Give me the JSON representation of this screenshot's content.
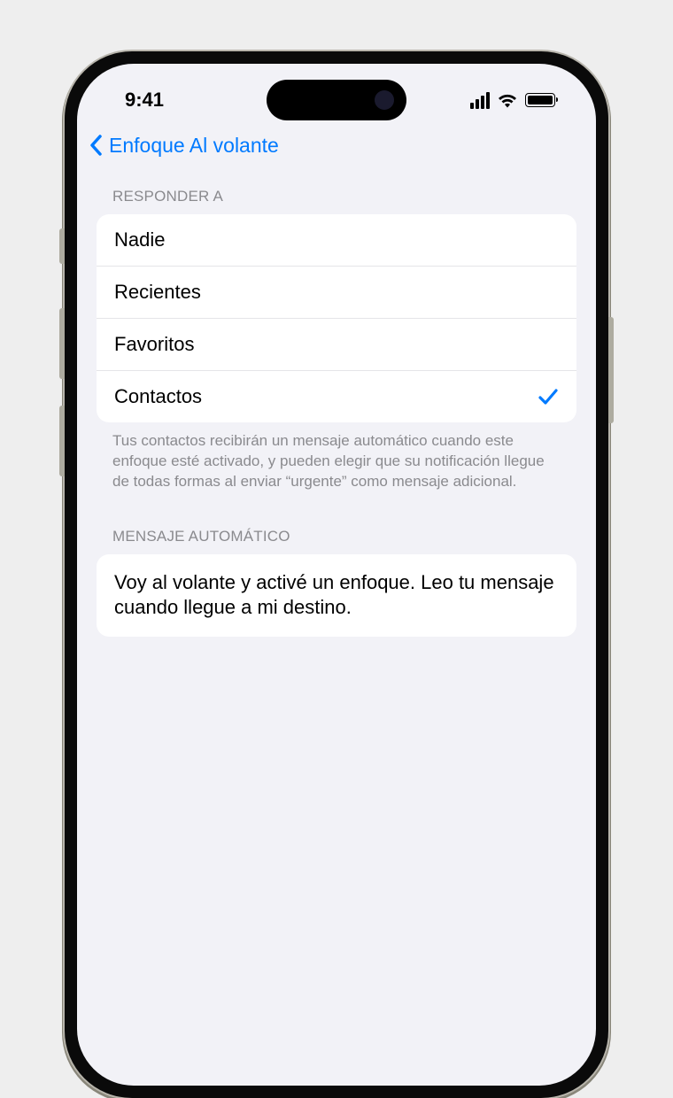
{
  "statusBar": {
    "time": "9:41"
  },
  "nav": {
    "backLabel": "Enfoque Al volante"
  },
  "sections": {
    "respondTo": {
      "header": "RESPONDER A",
      "options": [
        {
          "label": "Nadie",
          "selected": false
        },
        {
          "label": "Recientes",
          "selected": false
        },
        {
          "label": "Favoritos",
          "selected": false
        },
        {
          "label": "Contactos",
          "selected": true
        }
      ],
      "footer": "Tus contactos recibirán un mensaje automático cuando este enfoque esté activado, y pueden elegir que su notificación llegue de todas formas al enviar “urgente” como mensaje adicional."
    },
    "autoMessage": {
      "header": "MENSAJE AUTOMÁTICO",
      "body": "Voy al volante y activé un enfoque. Leo tu mensaje cuando llegue a mi destino."
    }
  }
}
